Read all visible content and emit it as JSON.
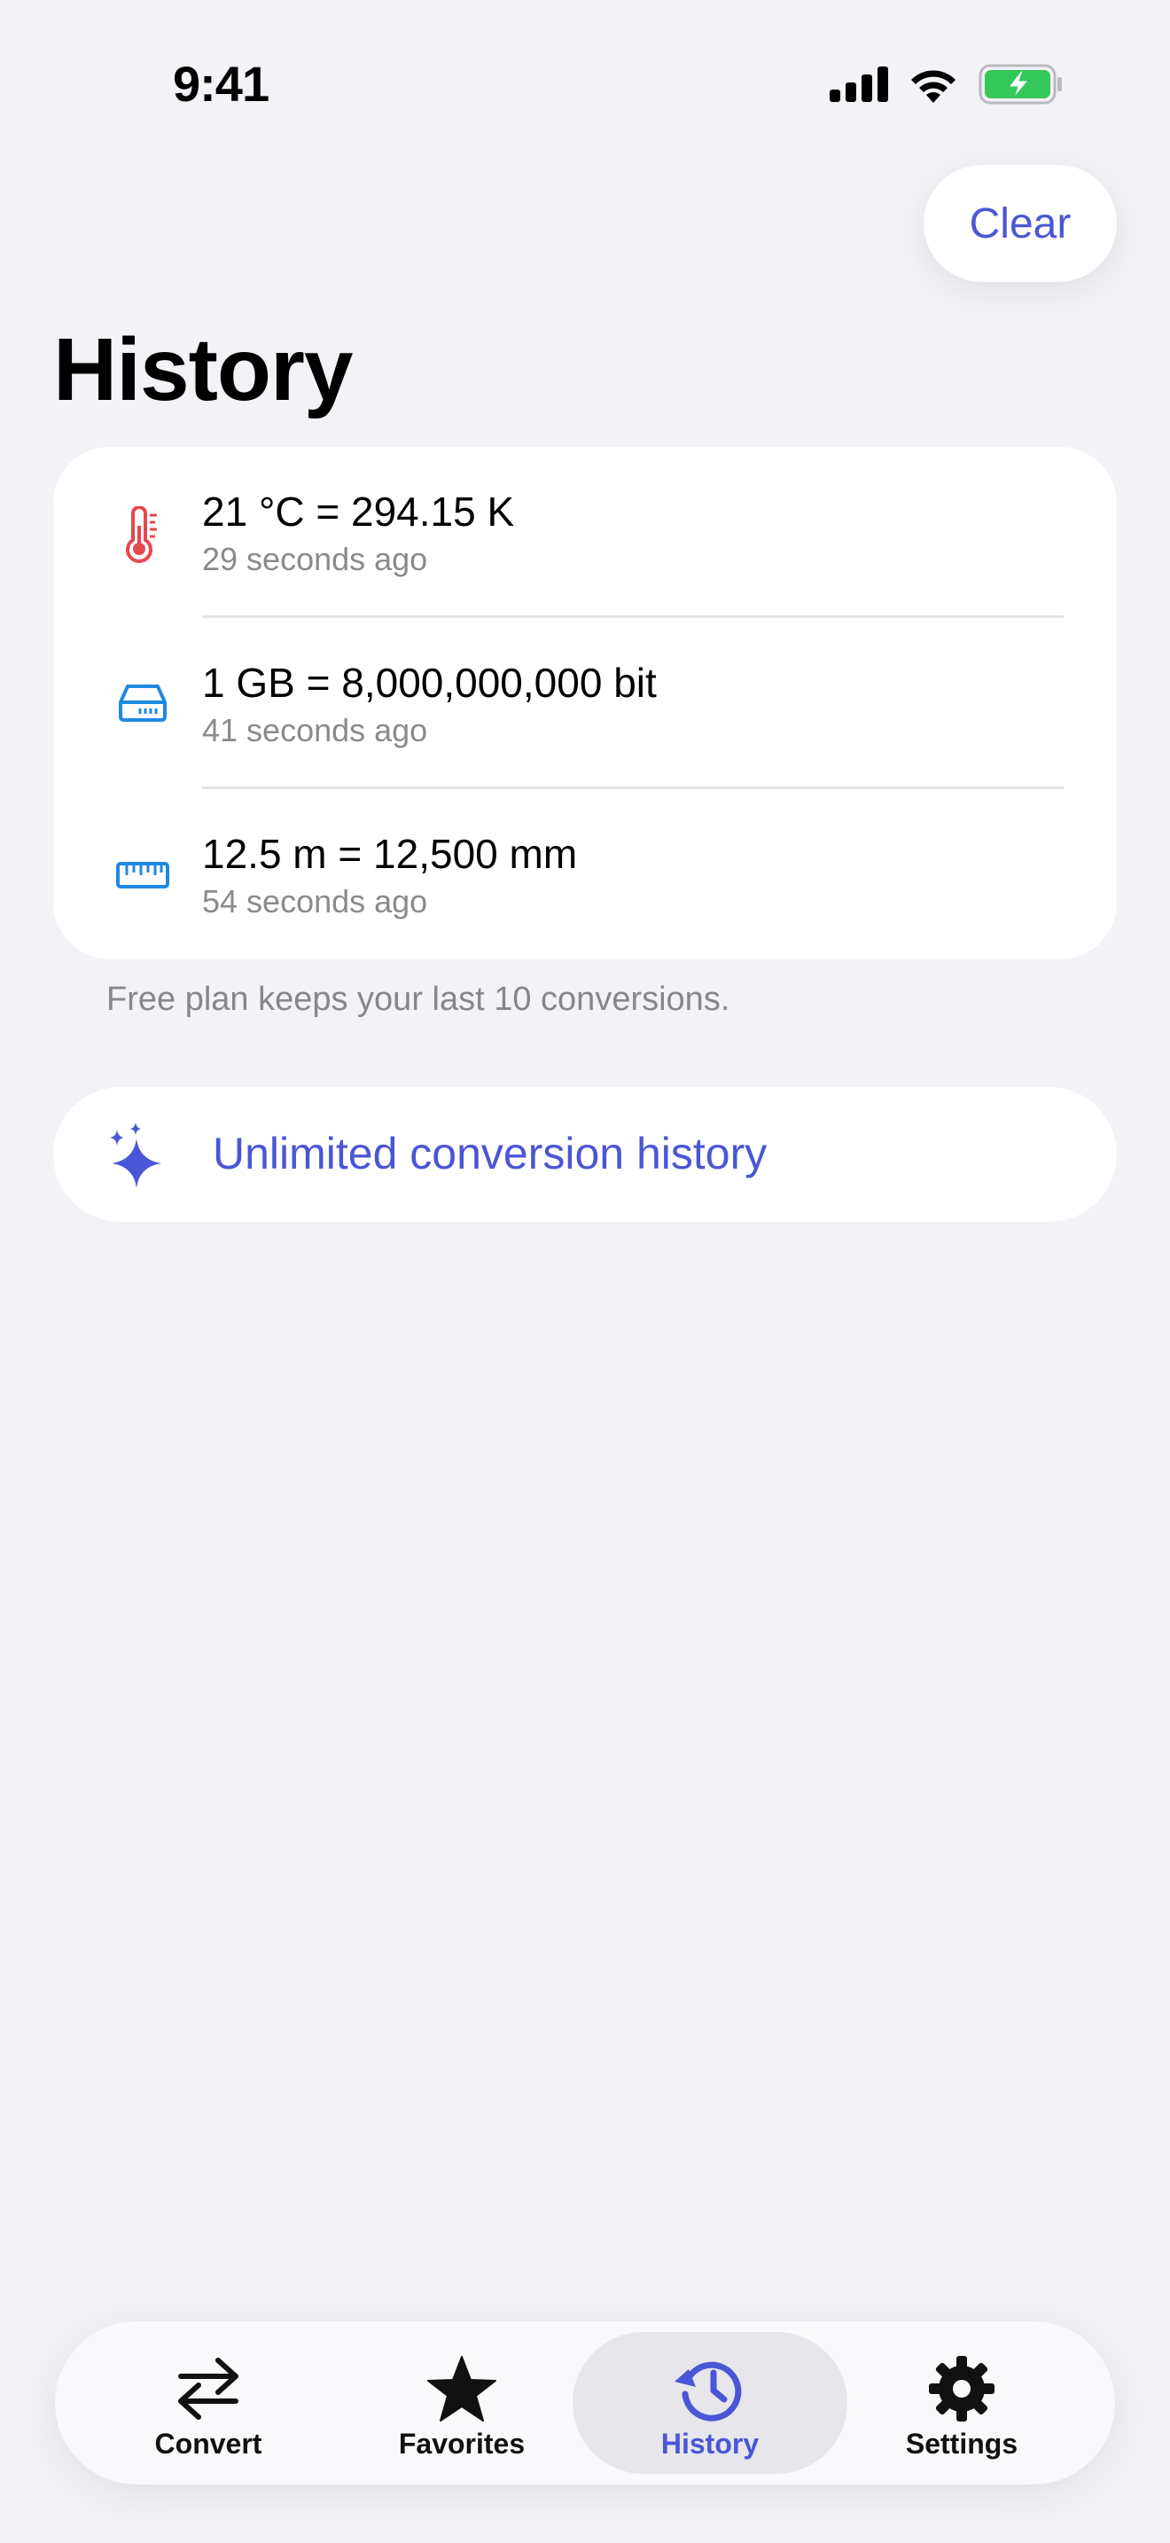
{
  "status_bar": {
    "time": "9:41"
  },
  "toolbar": {
    "clear_label": "Clear"
  },
  "page": {
    "title": "History"
  },
  "history": {
    "items": [
      {
        "icon": "thermometer-icon",
        "conversion": "21 °C = 294.15 K",
        "time_ago": "29 seconds ago",
        "icon_color": "#E5484D"
      },
      {
        "icon": "storage-drive-icon",
        "conversion": "1 GB = 8,000,000,000 bit",
        "time_ago": "41 seconds ago",
        "icon_color": "#1E88E5"
      },
      {
        "icon": "ruler-icon",
        "conversion": "12.5 m = 12,500 mm",
        "time_ago": "54 seconds ago",
        "icon_color": "#1E88E5"
      }
    ],
    "footnote": "Free plan keeps your last 10 conversions."
  },
  "upsell": {
    "icon": "sparkles-icon",
    "label": "Unlimited conversion history"
  },
  "tab_bar": {
    "tabs": [
      {
        "label": "Convert",
        "icon": "arrows-swap-icon",
        "selected": false
      },
      {
        "label": "Favorites",
        "icon": "star-icon",
        "selected": false
      },
      {
        "label": "History",
        "icon": "clock-history-icon",
        "selected": true
      },
      {
        "label": "Settings",
        "icon": "gear-icon",
        "selected": false
      }
    ]
  },
  "colors": {
    "accent": "#4A56D6",
    "background": "#F2F2F7",
    "battery_fill": "#34C759"
  }
}
